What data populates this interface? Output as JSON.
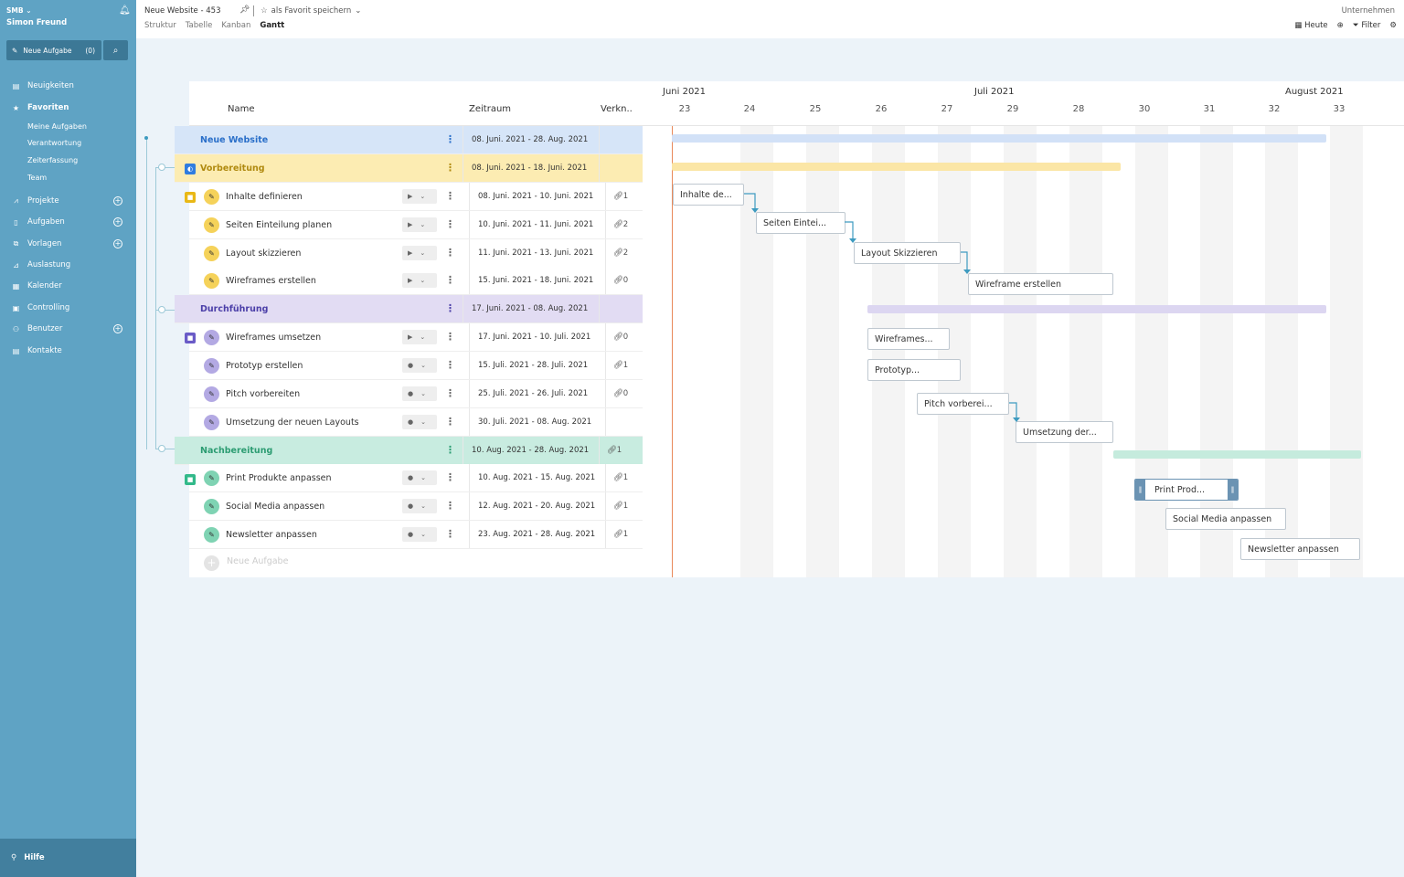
{
  "sidebar": {
    "org": "SMB ⌄",
    "user": "Simon Freund",
    "new_task": "Neue Aufgabe",
    "new_task_count": "(0)",
    "nav": [
      {
        "label": "Neuigkeiten",
        "icon": "news-icon",
        "bold": false,
        "add": false
      },
      {
        "label": "Favoriten",
        "icon": "star-icon",
        "bold": true,
        "add": false
      },
      {
        "label": "Projekte",
        "icon": "chart-icon",
        "bold": false,
        "add": true
      },
      {
        "label": "Aufgaben",
        "icon": "document-icon",
        "bold": false,
        "add": true
      },
      {
        "label": "Vorlagen",
        "icon": "copy-icon",
        "bold": false,
        "add": true
      },
      {
        "label": "Auslastung",
        "icon": "bar-chart-icon",
        "bold": false,
        "add": false
      },
      {
        "label": "Kalender",
        "icon": "calendar-icon",
        "bold": false,
        "add": false
      },
      {
        "label": "Controlling",
        "icon": "controlling-icon",
        "bold": false,
        "add": false
      },
      {
        "label": "Benutzer",
        "icon": "users-icon",
        "bold": false,
        "add": true
      },
      {
        "label": "Kontakte",
        "icon": "contacts-icon",
        "bold": false,
        "add": false
      }
    ],
    "favorites": [
      "Meine Aufgaben",
      "Verantwortung",
      "Zeiterfassung",
      "Team"
    ],
    "help": "Hilfe"
  },
  "topbar": {
    "title": "Neue Website - 453",
    "favorite": "als Favorit speichern",
    "tabs": [
      "Struktur",
      "Tabelle",
      "Kanban",
      "Gantt"
    ],
    "active_tab": "Gantt",
    "company": "Unternehmen",
    "today": "Heute",
    "filter": "Filter"
  },
  "table": {
    "headers": {
      "name": "Name",
      "zeitraum": "Zeitraum",
      "verk": "Verkn.."
    },
    "rows": [
      {
        "type": "group",
        "name": "Neue Website",
        "range": "08. Juni. 2021 - 28. Aug. 2021",
        "links": "",
        "color": "#d6e5f8",
        "text": "#2a6fc9"
      },
      {
        "type": "group",
        "name": "Vorbereitung",
        "range": "08. Juni. 2021 - 18. Juni. 2021",
        "links": "",
        "color": "#fcecb2",
        "text": "#b08a10"
      },
      {
        "type": "task",
        "name": "Inhalte definieren",
        "range": "08. Juni. 2021 - 10. Juni. 2021",
        "links": "1",
        "accent": "#f5d25a",
        "ctrl": "▶"
      },
      {
        "type": "task",
        "name": "Seiten Einteilung planen",
        "range": "10. Juni. 2021 - 11. Juni. 2021",
        "links": "2",
        "accent": "#f5d25a",
        "ctrl": "▶"
      },
      {
        "type": "task",
        "name": "Layout skizzieren",
        "range": "11. Juni. 2021 - 13. Juni. 2021",
        "links": "2",
        "accent": "#f5d25a",
        "ctrl": "▶"
      },
      {
        "type": "task",
        "name": "Wireframes erstellen",
        "range": "15. Juni. 2021 - 18. Juni. 2021",
        "links": "0",
        "accent": "#f5d25a",
        "ctrl": "▶"
      },
      {
        "type": "group",
        "name": "Durchführung",
        "range": "17. Juni. 2021 - 08. Aug. 2021",
        "links": "",
        "color": "#e2dcf3",
        "text": "#4b3fa8"
      },
      {
        "type": "task",
        "name": "Wireframes umsetzen",
        "range": "17. Juni. 2021 - 10. Juli. 2021",
        "links": "0",
        "accent": "#b3a9e3",
        "ctrl": "▶"
      },
      {
        "type": "task",
        "name": "Prototyp erstellen",
        "range": "15. Juli. 2021 - 28. Juli. 2021",
        "links": "1",
        "accent": "#b3a9e3",
        "ctrl": "●"
      },
      {
        "type": "task",
        "name": "Pitch vorbereiten",
        "range": "25. Juli. 2021 - 26. Juli. 2021",
        "links": "0",
        "accent": "#b3a9e3",
        "ctrl": "●"
      },
      {
        "type": "task",
        "name": "Umsetzung der neuen Layouts",
        "range": "30. Juli. 2021 - 08. Aug. 2021",
        "links": "",
        "accent": "#b3a9e3",
        "ctrl": "●"
      },
      {
        "type": "group",
        "name": "Nachbereitung",
        "range": "10. Aug. 2021 - 28. Aug. 2021",
        "links": "1",
        "color": "#c8ece0",
        "text": "#2c9c72"
      },
      {
        "type": "task",
        "name": "Print Produkte anpassen",
        "range": "10. Aug. 2021 - 15. Aug. 2021",
        "links": "1",
        "accent": "#7fd3b3",
        "ctrl": "●"
      },
      {
        "type": "task",
        "name": "Social Media anpassen",
        "range": "12. Aug. 2021 - 20. Aug. 2021",
        "links": "1",
        "accent": "#7fd3b3",
        "ctrl": "●"
      },
      {
        "type": "task",
        "name": "Newsletter anpassen",
        "range": "23. Aug. 2021 - 28. Aug. 2021",
        "links": "1",
        "accent": "#7fd3b3",
        "ctrl": "●"
      }
    ],
    "new_task": "Neue Aufgabe"
  },
  "gantt": {
    "months": [
      "Juni 2021",
      "Juli 2021",
      "August 2021"
    ],
    "weeks": [
      "23",
      "24",
      "25",
      "26",
      "27",
      "29",
      "28",
      "30",
      "31",
      "32",
      "33"
    ],
    "bars": [
      "Inhalte de...",
      "Seiten Eintei...",
      "Layout Skizzieren",
      "Wireframe erstellen",
      "Wireframes...",
      "Prototyp...",
      "Pitch vorberei...",
      "Umsetzung der...",
      "Print Prod...",
      "Social Media anpassen",
      "Newsletter anpassen"
    ]
  }
}
